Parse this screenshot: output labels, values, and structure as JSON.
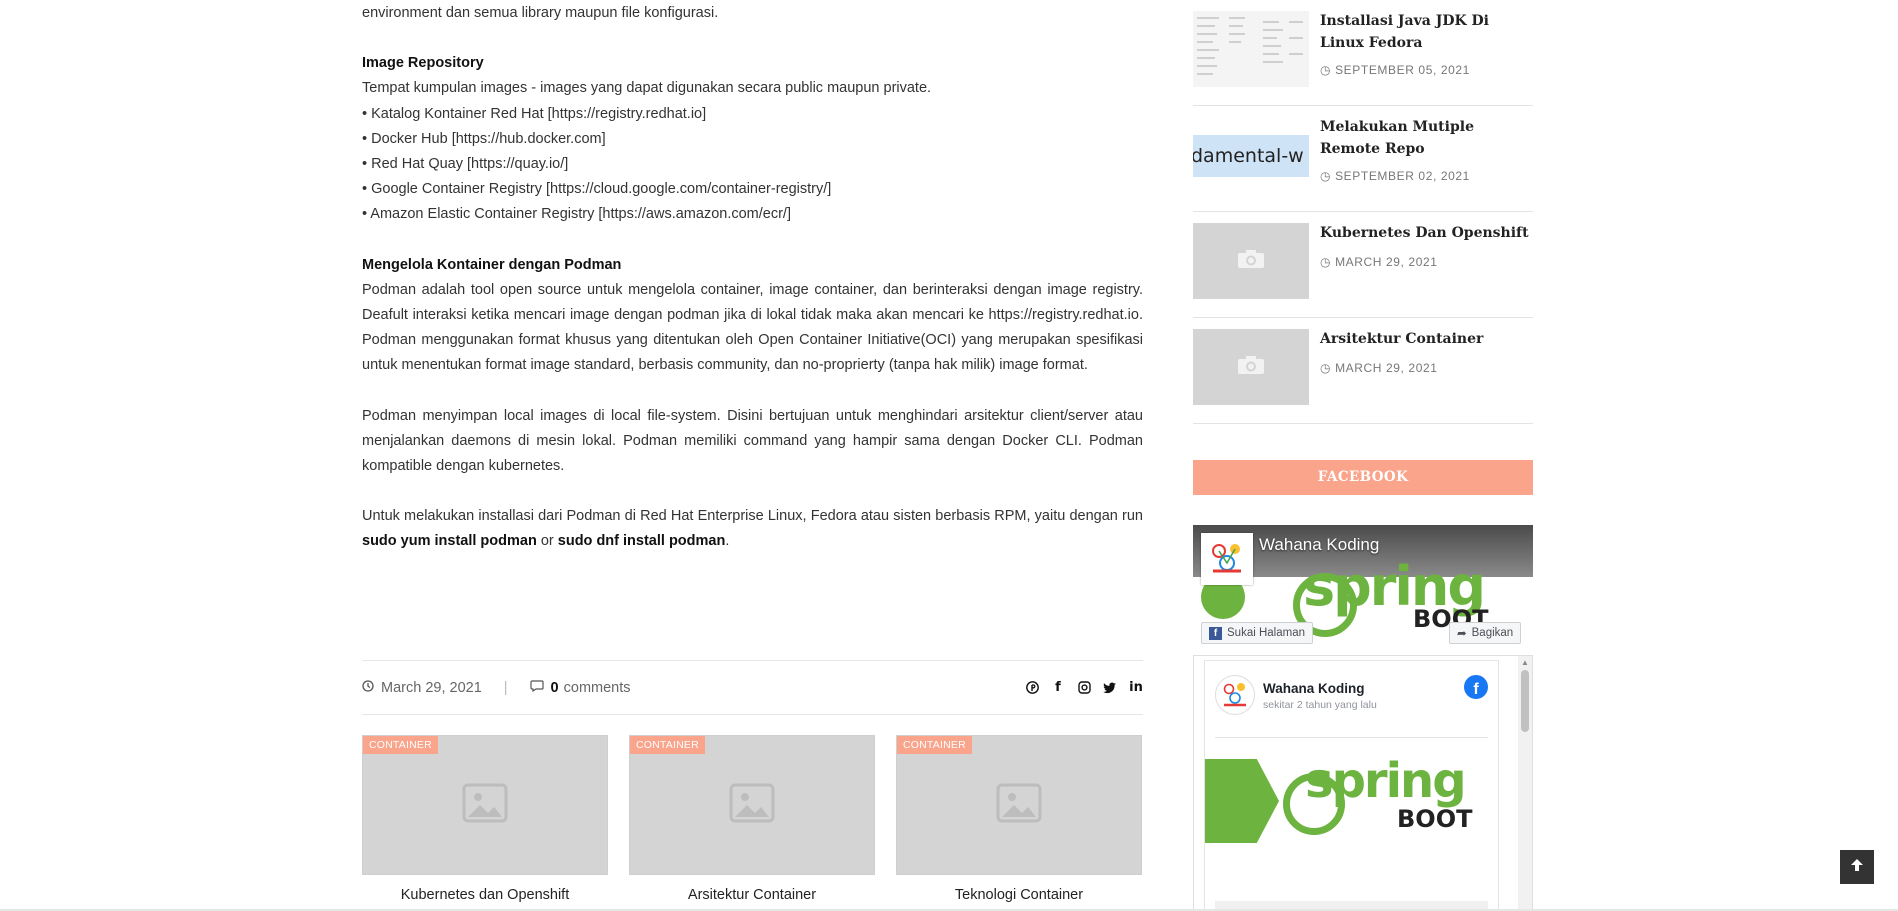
{
  "article": {
    "intro_line": "environment dan semua library maupun file konfigurasi.",
    "image_repo": {
      "heading": "Image Repository",
      "desc": "Tempat kumpulan images - images yang dapat digunakan secara public maupun private.",
      "items": [
        "• Katalog Kontainer Red Hat [https://registry.redhat.io]",
        "• Docker Hub [https://hub.docker.com]",
        "• Red Hat Quay [https://quay.io/]",
        "• Google Container Registry [https://cloud.google.com/container-registry/]",
        "• Amazon Elastic Container Registry [https://aws.amazon.com/ecr/]"
      ]
    },
    "podman": {
      "heading": "Mengelola Kontainer dengan Podman",
      "para1": "Podman adalah tool open source untuk mengelola container, image container, dan berinteraksi dengan image registry. Deafult interaksi ketika mencari image dengan podman  jika di lokal tidak maka akan mencari ke https://registry.redhat.io. Podman menggunakan format khusus yang ditentukan oleh Open Container Initiative(OCI) yang merupakan spesifikasi untuk menentukan format image standard, berbasis community, dan no-proprierty (tanpa hak milik) image format.",
      "para2": "Podman menyimpan local images di local file-system. Disini bertujuan untuk menghindari arsitektur client/server atau menjalankan daemons di mesin lokal. Podman memiliki command yang hampir sama dengan Docker CLI. Podman kompatible dengan kubernetes.",
      "para3_text": "Untuk melakukan installasi dari Podman di Red Hat Enterprise Linux, Fedora atau sisten berbasis RPM, yaitu dengan run ",
      "cmd1": "sudo yum install podman",
      "or_word": " or ",
      "cmd2": "sudo dnf install podman",
      "end_dot": "."
    }
  },
  "meta": {
    "date": "March 29, 2021",
    "separator": "|",
    "comment_count": "0",
    "comment_label": "comments"
  },
  "share_icons": [
    "pinterest-icon",
    "facebook-icon",
    "instagram-icon",
    "twitter-icon",
    "linkedin-icon"
  ],
  "related": [
    {
      "tag": "CONTAINER",
      "title": "Kubernetes dan Openshift"
    },
    {
      "tag": "CONTAINER",
      "title": "Arsitektur Container"
    },
    {
      "tag": "CONTAINER",
      "title": "Teknologi Container"
    }
  ],
  "popular": [
    {
      "title": "Installasi Java JDK Di Linux Fedora",
      "date": "SEPTEMBER 05, 2021"
    },
    {
      "title": "Melakukan Mutiple Remote Repo",
      "date": "SEPTEMBER 02, 2021",
      "thumb_text": "damental-w"
    },
    {
      "title": "Kubernetes Dan Openshift",
      "date": "MARCH 29, 2021"
    },
    {
      "title": "Arsitektur Container",
      "date": "MARCH 29, 2021"
    }
  ],
  "facebook_widget": {
    "heading": "FACEBOOK",
    "page_name": "Wahana Koding",
    "cover_word1": "spring",
    "cover_word2": "BOOT",
    "like_label": "Sukai Halaman",
    "share_label": "Bagikan",
    "post_author": "Wahana Koding",
    "post_time": "sekitar 2 tahun yang lalu"
  },
  "colors": {
    "accent": "#f9a48b",
    "spring_green": "#6db33f",
    "facebook_blue": "#1877f2"
  }
}
